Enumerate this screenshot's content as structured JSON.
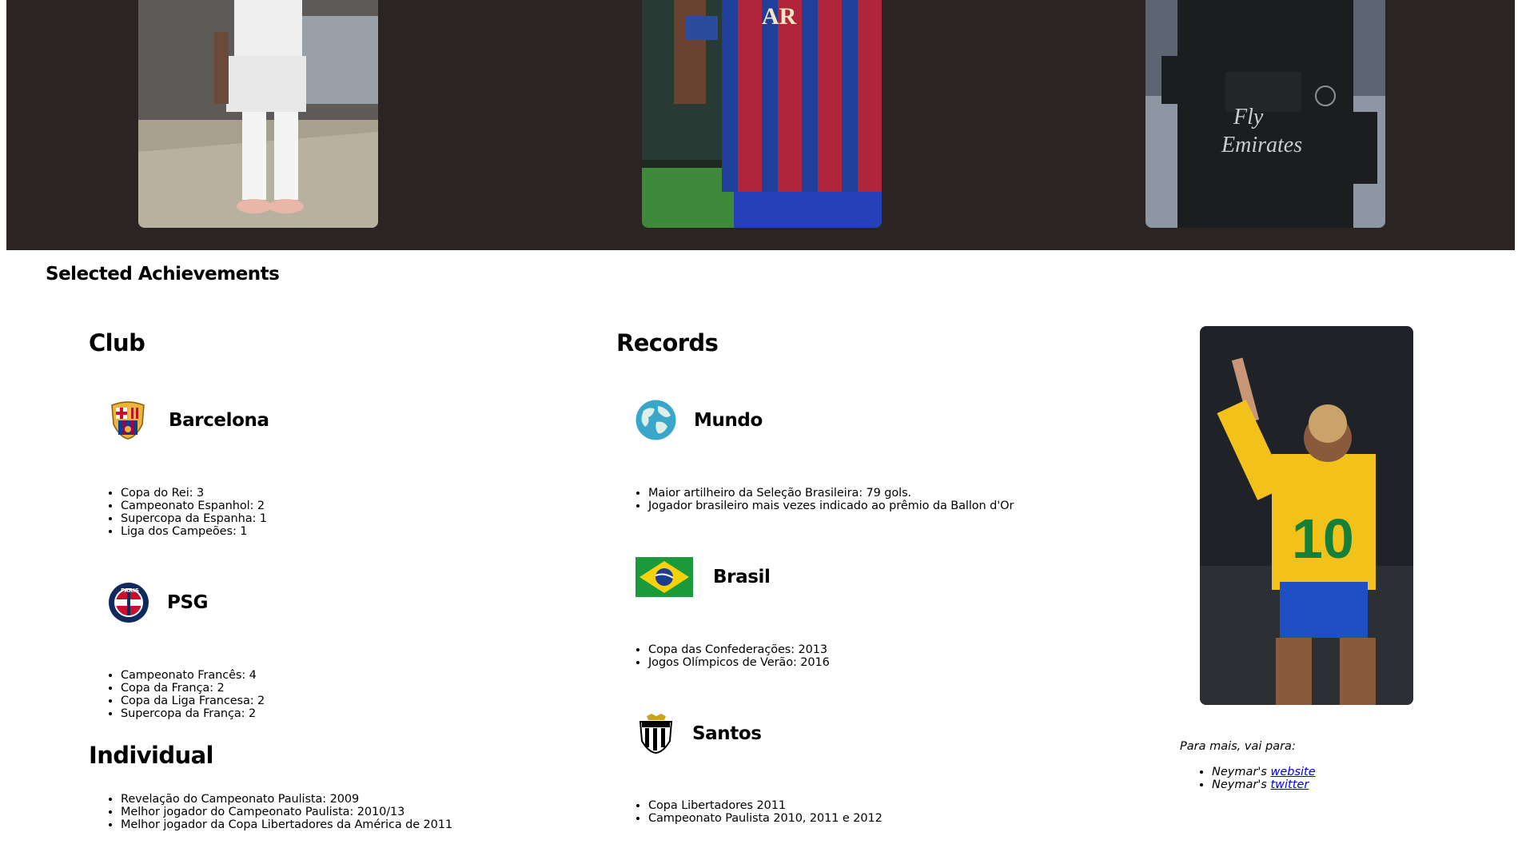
{
  "gallery": [
    {
      "icon": "santos-player-photo"
    },
    {
      "icon": "barcelona-player-photo"
    },
    {
      "icon": "psg-player-photo"
    }
  ],
  "achievements": {
    "title": "Selected Achievements",
    "club": {
      "heading": "Club",
      "teams": [
        {
          "name": "Barcelona",
          "icon": "barcelona-crest-icon",
          "items": [
            "Copa do Rei: 3",
            "Campeonato Espanhol: 2",
            "Supercopa da Espanha: 1",
            "Liga dos Campeões: 1"
          ]
        },
        {
          "name": "PSG",
          "icon": "psg-crest-icon",
          "items": [
            "Campeonato Francês: 4",
            "Copa da França: 2",
            "Copa da Liga Francesa: 2",
            "Supercopa da França: 2"
          ]
        }
      ]
    },
    "individual": {
      "heading": "Individual",
      "items": [
        "Revelação do Campeonato Paulista: 2009",
        "Melhor jogador do Campeonato Paulista: 2010/13",
        "Melhor jogador da Copa Libertadores da América de 2011"
      ]
    },
    "records": {
      "heading": "Records",
      "groups": [
        {
          "name": "Mundo",
          "icon": "globe-icon",
          "items": [
            "Maior artilheiro da Seleção Brasileira: 79 gols.",
            "Jogador brasileiro mais vezes indicado ao prêmio da Ballon d'Or"
          ]
        },
        {
          "name": "Brasil",
          "icon": "brazil-flag-icon",
          "items": [
            "Copa das Confederações: 2013",
            "Jogos Olímpicos de Verão: 2016"
          ]
        },
        {
          "name": "Santos",
          "icon": "santos-crest-icon",
          "items": [
            "Copa Libertadores 2011",
            "Campeonato Paulista 2010, 2011 e 2012"
          ]
        }
      ]
    }
  },
  "sidebar": {
    "photo_icon": "brazil-player-photo",
    "more_text": "Para mais, vai para:",
    "links": [
      {
        "prefix": "Neymar's ",
        "label": "website"
      },
      {
        "prefix": "Neymar's ",
        "label": "twitter"
      }
    ]
  },
  "colors": {
    "hero_background": "#2a2522",
    "link": "#0000ee"
  }
}
